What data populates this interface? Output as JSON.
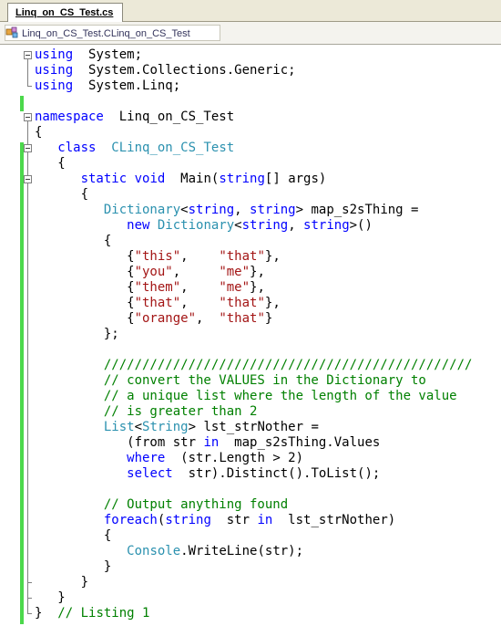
{
  "tab": {
    "label": "Linq_on_CS_Test.cs"
  },
  "navbar": {
    "class_path": "Linq_on_CS_Test.CLinq_on_CS_Test"
  },
  "code": [
    [
      [
        "kw",
        "using"
      ],
      [
        "",
        "  System;"
      ]
    ],
    [
      [
        "kw",
        "using"
      ],
      [
        "",
        "  System.Collections.Generic;"
      ]
    ],
    [
      [
        "kw",
        "using"
      ],
      [
        "",
        "  System.Linq;"
      ]
    ],
    [],
    [
      [
        "kw",
        "namespace"
      ],
      [
        "",
        "  Linq_on_CS_Test"
      ]
    ],
    [
      [
        "",
        "{"
      ]
    ],
    [
      [
        "",
        "   "
      ],
      [
        "kw",
        "class"
      ],
      [
        "",
        ""
      ],
      [
        "ty",
        "  CLinq_on_CS_Test"
      ]
    ],
    [
      [
        "",
        "   {"
      ]
    ],
    [
      [
        "",
        "      "
      ],
      [
        "kw",
        "static"
      ],
      [
        "",
        ""
      ],
      [
        "kw",
        " void"
      ],
      [
        "",
        "  Main("
      ],
      [
        "kw",
        "string"
      ],
      [
        "",
        "[] args)"
      ]
    ],
    [
      [
        "",
        "      {"
      ]
    ],
    [
      [
        "",
        "         "
      ],
      [
        "ty",
        "Dictionary"
      ],
      [
        "",
        "<"
      ],
      [
        "kw",
        "string"
      ],
      [
        "",
        ", "
      ],
      [
        "kw",
        "string"
      ],
      [
        "",
        "> map_s2sThing ="
      ]
    ],
    [
      [
        "",
        "            "
      ],
      [
        "kw",
        "new"
      ],
      [
        "",
        ""
      ],
      [
        "ty",
        " Dictionary"
      ],
      [
        "",
        "<"
      ],
      [
        "kw",
        "string"
      ],
      [
        "",
        ", "
      ],
      [
        "kw",
        "string"
      ],
      [
        "",
        ">()"
      ]
    ],
    [
      [
        "",
        "         {"
      ]
    ],
    [
      [
        "",
        "            {"
      ],
      [
        "st",
        "\"this\""
      ],
      [
        "",
        ",    "
      ],
      [
        "st",
        "\"that\""
      ],
      [
        "",
        "},"
      ]
    ],
    [
      [
        "",
        "            {"
      ],
      [
        "st",
        "\"you\""
      ],
      [
        "",
        ",     "
      ],
      [
        "st",
        "\"me\""
      ],
      [
        "",
        "},"
      ]
    ],
    [
      [
        "",
        "            {"
      ],
      [
        "st",
        "\"them\""
      ],
      [
        "",
        ",    "
      ],
      [
        "st",
        "\"me\""
      ],
      [
        "",
        "},"
      ]
    ],
    [
      [
        "",
        "            {"
      ],
      [
        "st",
        "\"that\""
      ],
      [
        "",
        ",    "
      ],
      [
        "st",
        "\"that\""
      ],
      [
        "",
        "},"
      ]
    ],
    [
      [
        "",
        "            {"
      ],
      [
        "st",
        "\"orange\""
      ],
      [
        "",
        ",  "
      ],
      [
        "st",
        "\"that\""
      ],
      [
        "",
        "}"
      ]
    ],
    [
      [
        "",
        "         };"
      ]
    ],
    [],
    [
      [
        "",
        "         "
      ],
      [
        "cm",
        "////////////////////////////////////////////////"
      ]
    ],
    [
      [
        "",
        "         "
      ],
      [
        "cm",
        "// convert the VALUES in the Dictionary to"
      ]
    ],
    [
      [
        "",
        "         "
      ],
      [
        "cm",
        "// a unique list where the length of the value"
      ]
    ],
    [
      [
        "",
        "         "
      ],
      [
        "cm",
        "// is greater than 2"
      ]
    ],
    [
      [
        "",
        "         "
      ],
      [
        "ty",
        "List"
      ],
      [
        "",
        "<"
      ],
      [
        "ty",
        "String"
      ],
      [
        "",
        "> lst_strNother ="
      ]
    ],
    [
      [
        "",
        "            (from str "
      ],
      [
        "kw",
        "in"
      ],
      [
        "",
        ""
      ],
      [
        "",
        "  map_s2sThing.Values"
      ]
    ],
    [
      [
        "",
        "            "
      ],
      [
        "kw",
        "where"
      ],
      [
        "",
        ""
      ],
      [
        "",
        "  (str.Length > 2)"
      ]
    ],
    [
      [
        "",
        "            "
      ],
      [
        "kw",
        "select"
      ],
      [
        "",
        ""
      ],
      [
        "",
        "  str).Distinct().ToList();"
      ]
    ],
    [],
    [
      [
        "",
        "         "
      ],
      [
        "cm",
        "// Output anything found"
      ]
    ],
    [
      [
        "",
        "         "
      ],
      [
        "kw",
        "foreach"
      ],
      [
        "",
        "("
      ],
      [
        "kw",
        "string"
      ],
      [
        "",
        ""
      ],
      [
        "",
        ""
      ],
      [
        "",
        "  str "
      ],
      [
        "kw",
        "in"
      ],
      [
        "",
        ""
      ],
      [
        "",
        "  lst_strNother)"
      ]
    ],
    [
      [
        "",
        "         {"
      ]
    ],
    [
      [
        "",
        "            "
      ],
      [
        "ty",
        "Console"
      ],
      [
        "",
        ".WriteLine(str);"
      ]
    ],
    [
      [
        "",
        "         }"
      ]
    ],
    [
      [
        "",
        "      }"
      ]
    ],
    [
      [
        "",
        "   }"
      ]
    ],
    [
      [
        "",
        "}"
      ],
      [
        "",
        ""
      ],
      [
        "cm",
        "  // Listing 1"
      ]
    ]
  ]
}
